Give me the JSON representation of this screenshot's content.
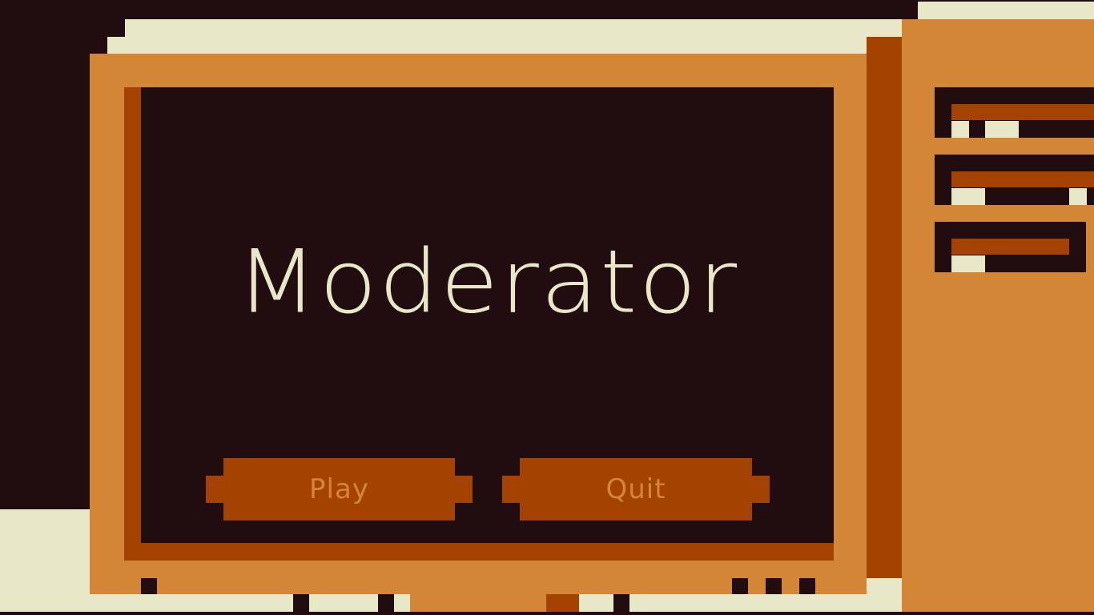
{
  "game": {
    "title": "Moderator"
  },
  "menu": {
    "play_label": "Play",
    "quit_label": "Quit"
  },
  "palette": {
    "background": "#210d10",
    "cream": "#e8e8c8",
    "orange": "#d38636",
    "rust": "#a44200"
  }
}
